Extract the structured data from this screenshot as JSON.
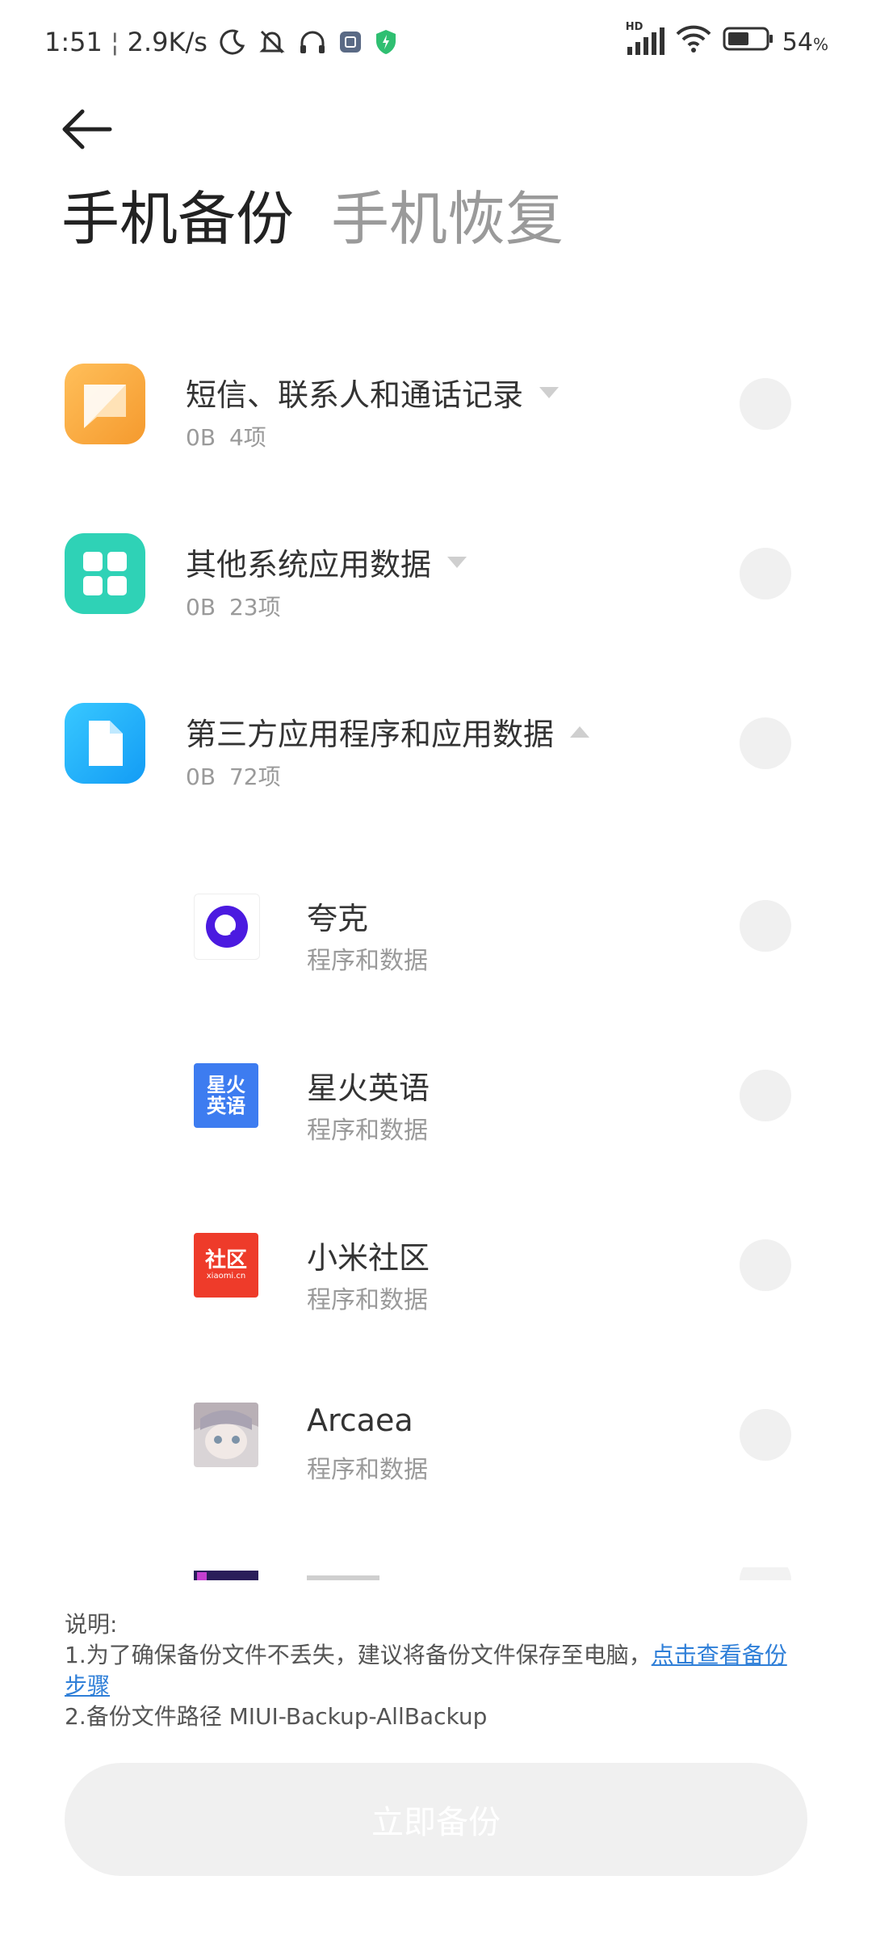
{
  "status": {
    "time": "1:51",
    "speed": "2.9K/s",
    "battery": "54",
    "battery_unit": "%",
    "network_label": "HD"
  },
  "header": {
    "tabs": [
      {
        "label": "手机备份",
        "active": true
      },
      {
        "label": "手机恢复",
        "active": false
      }
    ]
  },
  "categories": [
    {
      "title": "短信、联系人和通话记录",
      "size": "0B",
      "count": "4项",
      "expanded": false,
      "icon": "message-icon",
      "color": "#f7a83b"
    },
    {
      "title": "其他系统应用数据",
      "size": "0B",
      "count": "23项",
      "expanded": false,
      "icon": "grid-icon",
      "color": "#2fd2b6"
    },
    {
      "title": "第三方应用程序和应用数据",
      "size": "0B",
      "count": "72项",
      "expanded": true,
      "icon": "file-icon",
      "color": "#1fb7ff"
    }
  ],
  "apps": [
    {
      "name": "夸克",
      "desc": "程序和数据",
      "icon": "quark-icon"
    },
    {
      "name": "星火英语",
      "desc": "程序和数据",
      "icon": "xinghuo-icon",
      "icon_text": "星火\n英语"
    },
    {
      "name": "小米社区",
      "desc": "程序和数据",
      "icon": "community-icon",
      "icon_text": "社区",
      "icon_subtext": "xiaomi.cn"
    },
    {
      "name": "Arcaea",
      "desc": "程序和数据",
      "icon": "arcaea-icon"
    }
  ],
  "notes": {
    "heading": "说明:",
    "line1_prefix": "1.为了确保备份文件不丢失，建议将备份文件保存至电脑，",
    "line1_link": "点击查看备份步骤",
    "line2": "2.备份文件路径 MIUI-Backup-AllBackup"
  },
  "action": {
    "label": "立即备份"
  },
  "colors": {
    "link": "#2f7fd8",
    "button_bg": "#f0f0f0",
    "shield": "#2fbf71"
  }
}
